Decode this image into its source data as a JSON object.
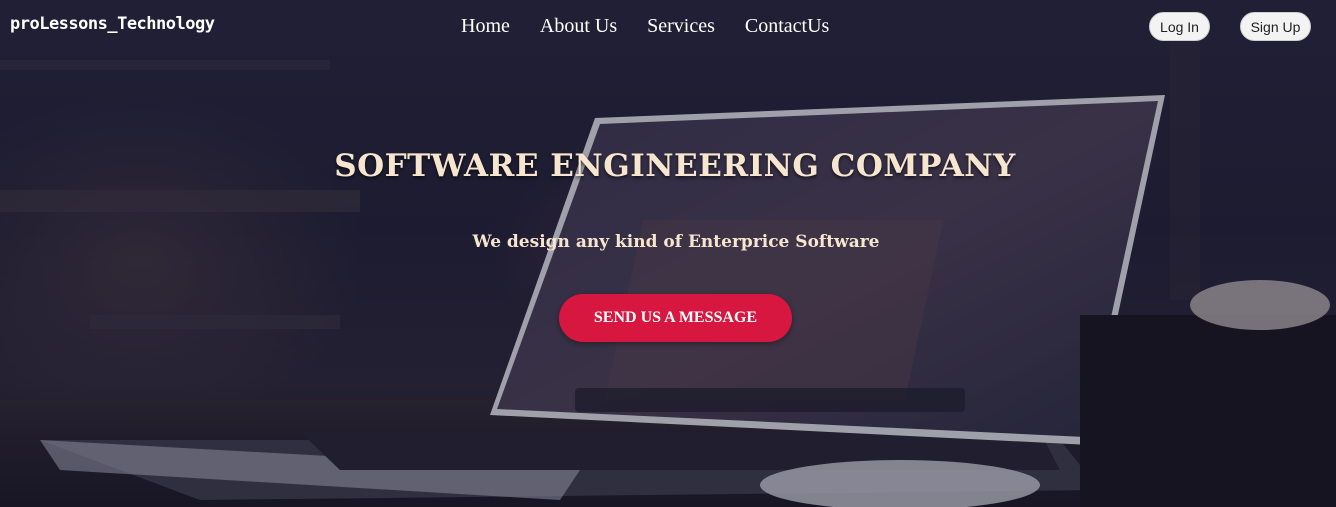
{
  "brand": {
    "name": "proLessons_Technology"
  },
  "nav": {
    "items": [
      "Home",
      "About Us",
      "Services",
      "ContactUs"
    ]
  },
  "auth": {
    "login_label": "Log In",
    "signup_label": "Sign Up"
  },
  "hero": {
    "title": "SOFTWARE ENGINEERING COMPANY",
    "subtitle": "We design any kind of Enterprice Software",
    "cta_label": "SEND US A MESSAGE"
  },
  "colors": {
    "accent": "#d81740",
    "title": "#f7e6cf",
    "overlay": "#1b1a2e"
  }
}
